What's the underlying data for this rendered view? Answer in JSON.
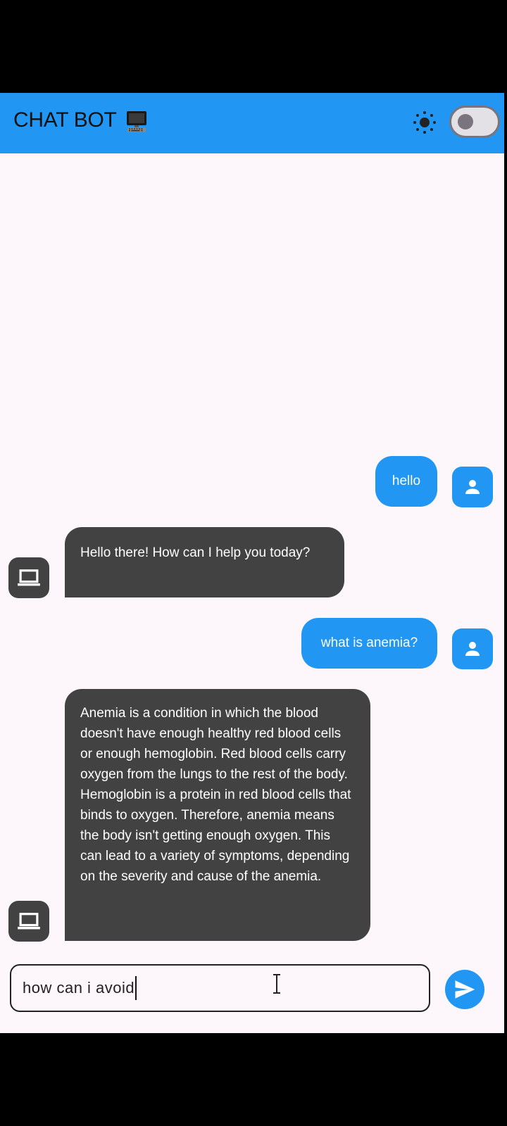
{
  "app_bar": {
    "title": "CHAT BOT",
    "title_icon": "computer-monitor-icon",
    "theme_icon": "sun-icon",
    "dark_mode_toggle": {
      "state": "off"
    },
    "color": "#2196F3"
  },
  "messages": [
    {
      "sender": "user",
      "text": "hello",
      "avatar_icon": "person-icon"
    },
    {
      "sender": "bot",
      "text": "Hello there! How can I help you today?",
      "avatar_icon": "laptop-icon"
    },
    {
      "sender": "user",
      "text": "what is anemia?",
      "avatar_icon": "person-icon"
    },
    {
      "sender": "bot",
      "text": "Anemia is a condition in which the blood doesn't have enough healthy red blood cells or enough hemoglobin.  Red blood cells carry oxygen from the lungs to the rest of the body.  Hemoglobin is a protein in red blood cells that binds to oxygen. Therefore, anemia means the body isn't getting enough oxygen.  This can lead to a variety of symptoms, depending on the severity and cause of the anemia.",
      "avatar_icon": "laptop-icon"
    }
  ],
  "composer": {
    "input_value": "how can i avoid",
    "send_icon": "send-icon"
  },
  "colors": {
    "user_bubble": "#2196F3",
    "bot_bubble": "#424242",
    "background": "#FDF7FB"
  }
}
